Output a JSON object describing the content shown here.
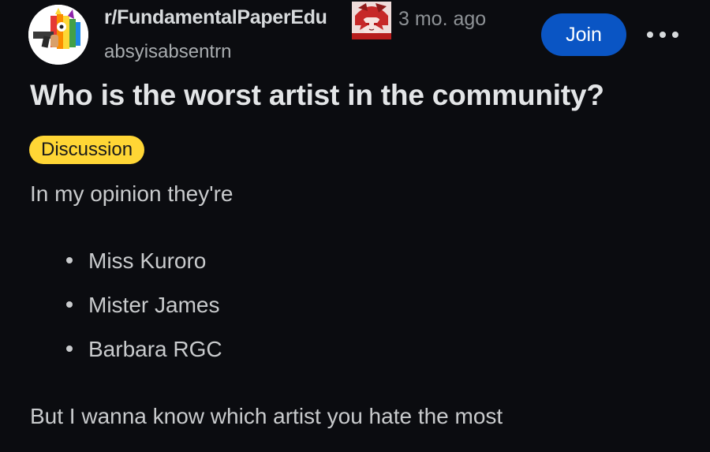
{
  "post": {
    "subreddit": "r/FundamentalPaperEdu",
    "time_ago": "3 mo. ago",
    "author": "absyisabsentrn",
    "join_label": "Join",
    "title": "Who is the worst artist in the community?",
    "flair": "Discussion",
    "intro": "In my opinion they're",
    "artists": [
      "Miss Kuroro",
      "Mister James",
      "Barbara RGC"
    ],
    "closing": "But I wanna know which artist you hate the most"
  },
  "colors": {
    "background": "#0b0c10",
    "join_button": "#0a55c4",
    "flair_tag": "#ffd635"
  },
  "icons": {
    "subreddit_avatar": "rainbow-creature-with-gun-icon",
    "user_flair": "anime-character-icon",
    "overflow": "more-horizontal-icon"
  }
}
